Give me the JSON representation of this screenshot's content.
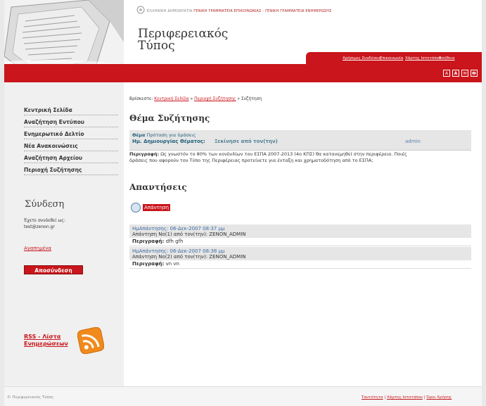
{
  "header": {
    "top_line_gray": "ΕΛΛΗΝΙΚΗ ΔΗΜΟΚΡΑΤΙΑ",
    "top_line_red": "ΓΕΝΙΚΗ ΓΡΑΜΜΑΤΕΙΑ ΕΠΙΚΟΙΝΩΝΙΑΣ - ΓΕΝΙΚΗ ΓΡΑΜΜΑΤΕΙΑ ΕΝΗΜΕΡΩΣΗΣ",
    "site_title_line1": "Περιφερειακός",
    "site_title_line2": "Τύπος",
    "tabs": [
      "Χρήσιμες Συνδέσεις",
      "Επικοινωνία",
      "Χάρτης Ιστοτόπου",
      "Βοήθεια"
    ],
    "icons": [
      "A",
      "A",
      "✉",
      "🖶"
    ],
    "colors": {
      "brand_red": "#c9151b"
    }
  },
  "nav": {
    "items": [
      "Κεντρική Σελίδα",
      "Αναζήτηση Εντύπου",
      "Ενημερωτικό Δελτίο",
      "Νέα Ανακοινώσεις",
      "Αναζήτηση Αρχείου",
      "Περιοχή Συζήτησης"
    ]
  },
  "login": {
    "title": "Σύνδεση",
    "logged_as": "Έχετε συνδεθεί ως:",
    "email": "test@zenon.gr",
    "favorites": "Αγαπημένα",
    "logout": "Αποσύνδεση"
  },
  "rss": {
    "line1": "RSS - Λίστα",
    "line2": "Ενημερώσεων"
  },
  "breadcrumb": {
    "prefix": "Βρίσκεστε:",
    "items": [
      "Κεντρική Σελίδα",
      "Περιοχή Συζήτησης"
    ],
    "current": "Συζήτηση",
    "sep": " » "
  },
  "topic": {
    "heading": "Θέμα Συζήτησης",
    "subject_label": "Θέμα",
    "subject": "Πρόταση για δράσεις",
    "created_label": "Ημ. Δημιουργίας Θέματος:",
    "created_overlap": "Ξεκίνησε από τον(την)",
    "author": "admin",
    "desc_label": "Περιγραφή:",
    "desc_line1": "Ως γνωστόν το 80% των κονδυλίων του ΕΣΠΑ 2007-2013 (4ο ΚΠΣ) θα κατανεμηθεί στην περιφέρεια. Ποιές",
    "desc_line2": "δράσεις που αφορούν τον Τύπο της Περιφέρειας προτείνετε για ένταξη και χρηματοδότηση από το ΕΣΠΑ;"
  },
  "answers": {
    "heading": "Απαντήσεις",
    "reply_button": "Απάντηση",
    "items": [
      {
        "date_label": "ΗμΑπάντησης:",
        "date": "06-Δεκ-2007 08:37 μμ",
        "by": "Απάντηση Νο(1) από τον(την): ZENON_ADMIN",
        "desc_label": "Περιγραφή:",
        "desc": "dfh gfh"
      },
      {
        "date_label": "ΗμΑπάντησης:",
        "date": "06-Δεκ-2007 08:38 μμ",
        "by": "Απάντηση Νο(2) από τον(την): ZENON_ADMIN",
        "desc_label": "Περιγραφή:",
        "desc": "vn vn"
      }
    ]
  },
  "footer": {
    "copyright": "© Περιφερειακός Τύπος",
    "links": [
      "Ταυτότητα",
      "Χάρτης Ιστοτόπου",
      "Όροι Χρήσης"
    ],
    "sep": " | "
  }
}
